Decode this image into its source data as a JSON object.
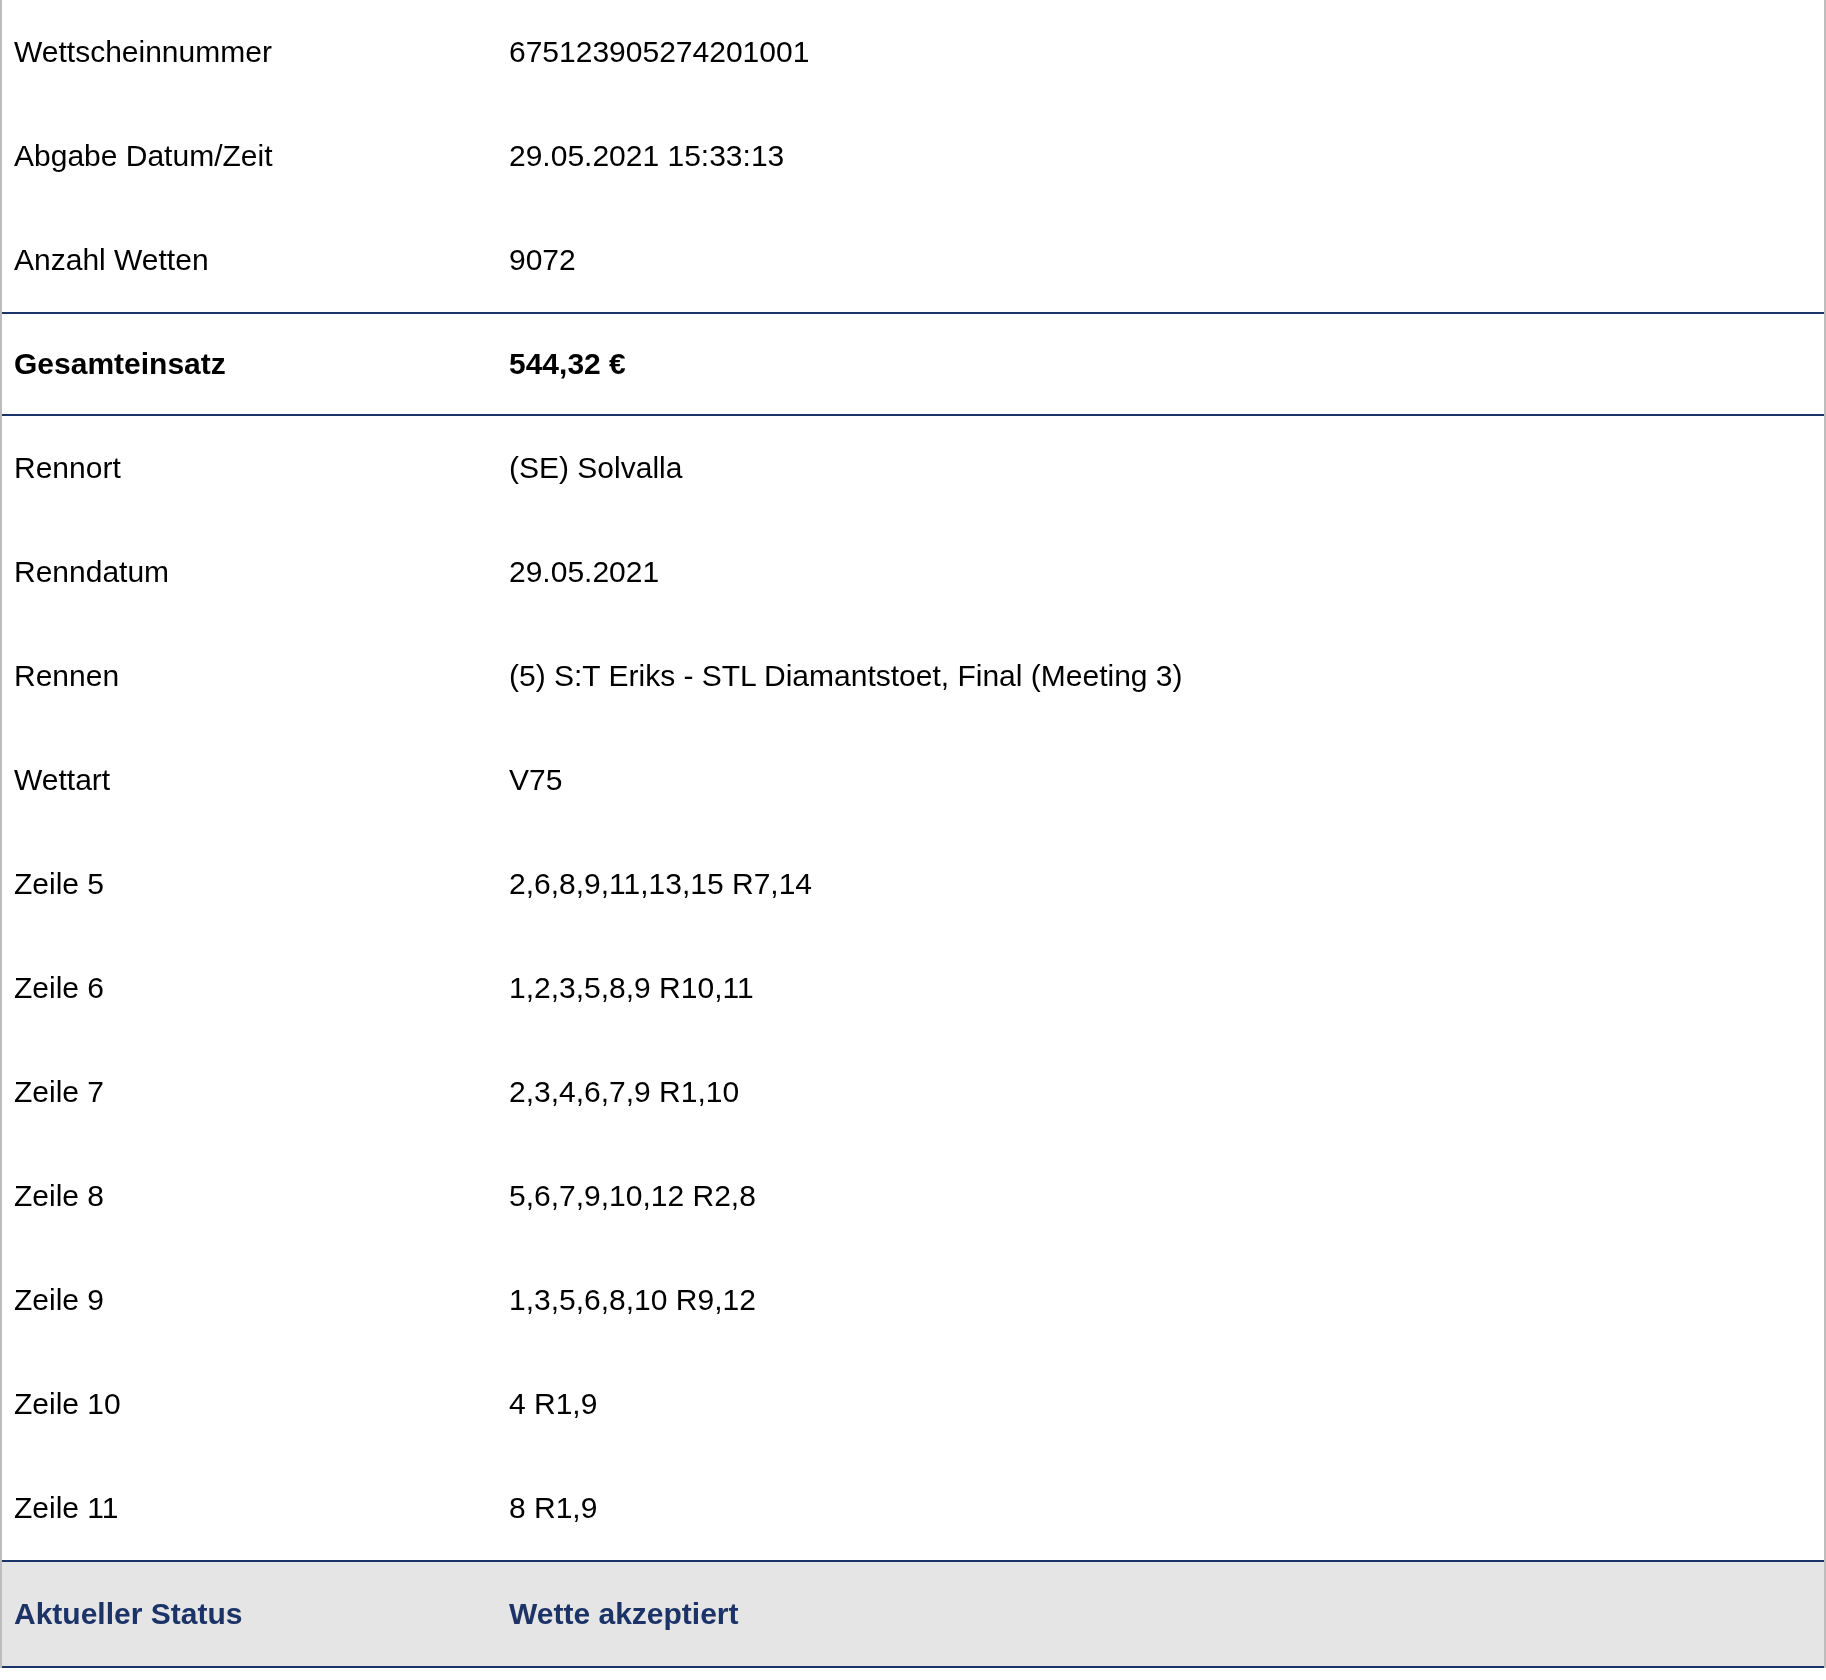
{
  "rows": [
    {
      "kind": "plain",
      "label": "Wettscheinnummer",
      "value": "675123905274201001"
    },
    {
      "kind": "plain",
      "label": "Abgabe Datum/Zeit",
      "value": "29.05.2021 15:33:13"
    },
    {
      "kind": "plain",
      "label": "Anzahl Wetten",
      "value": "9072"
    },
    {
      "kind": "total",
      "label": "Gesamteinsatz",
      "value": "544,32 €"
    },
    {
      "kind": "plain",
      "label": "Rennort",
      "value": "(SE) Solvalla"
    },
    {
      "kind": "plain",
      "label": "Renndatum",
      "value": "29.05.2021"
    },
    {
      "kind": "plain",
      "label": "Rennen",
      "value": "(5) S:T Eriks - STL Diamantstoet, Final (Meeting 3)"
    },
    {
      "kind": "plain",
      "label": "Wettart",
      "value": "V75"
    },
    {
      "kind": "plain",
      "label": "Zeile 5",
      "value": "2,6,8,9,11,13,15 R7,14"
    },
    {
      "kind": "plain",
      "label": "Zeile 6",
      "value": "1,2,3,5,8,9 R10,11"
    },
    {
      "kind": "plain",
      "label": "Zeile 7",
      "value": "2,3,4,6,7,9 R1,10"
    },
    {
      "kind": "plain",
      "label": "Zeile 8",
      "value": "5,6,7,9,10,12 R2,8"
    },
    {
      "kind": "plain",
      "label": "Zeile 9",
      "value": "1,3,5,6,8,10 R9,12"
    },
    {
      "kind": "plain",
      "label": "Zeile 10",
      "value": "4 R1,9"
    },
    {
      "kind": "plain",
      "label": "Zeile 11",
      "value": "8 R1,9"
    },
    {
      "kind": "status",
      "label": "Aktueller Status",
      "value": "Wette akzeptiert"
    }
  ]
}
